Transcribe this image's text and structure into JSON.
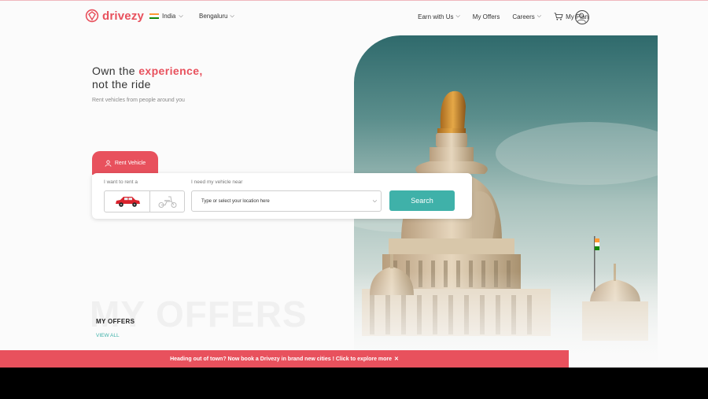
{
  "header": {
    "logo_text": "drivezy",
    "country_label": "India",
    "city_label": "Bengaluru",
    "nav": {
      "earn_label": "Earn with Us",
      "offers_label": "My Offers",
      "careers_label": "Careers",
      "plan_label": "My Plan"
    },
    "icons": {
      "logo": "drivezy-logo-icon",
      "flag": "india-flag-icon",
      "cart": "cart-icon",
      "avatar": "user-avatar-icon",
      "chevron": "chevron-down-icon"
    }
  },
  "hero": {
    "title_line1_prefix": "Own the ",
    "title_accent": "experience",
    "title_line1_suffix": ",",
    "title_line2": "not the ride",
    "subtitle": "Rent vehicles from people around you"
  },
  "booking": {
    "tab_label": "Rent Vehicle",
    "rent_label": "I want to rent a",
    "location_label": "I need my vehicle near",
    "location_placeholder": "Type or select your location here",
    "search_label": "Search",
    "vehicle_options": [
      "car",
      "scooter"
    ],
    "selected_vehicle": "car"
  },
  "offers": {
    "watermark": "MY OFFERS",
    "title": "MY OFFERS",
    "view_all_label": "VIEW ALL"
  },
  "banner": {
    "text": "Heading out of town? Now book a Drivezy in brand new cities ! Click to explore more",
    "close_glyph": "✕"
  },
  "colors": {
    "brand": "#e8515d",
    "accent_teal": "#3fb1a9",
    "text_dark": "#333333"
  }
}
